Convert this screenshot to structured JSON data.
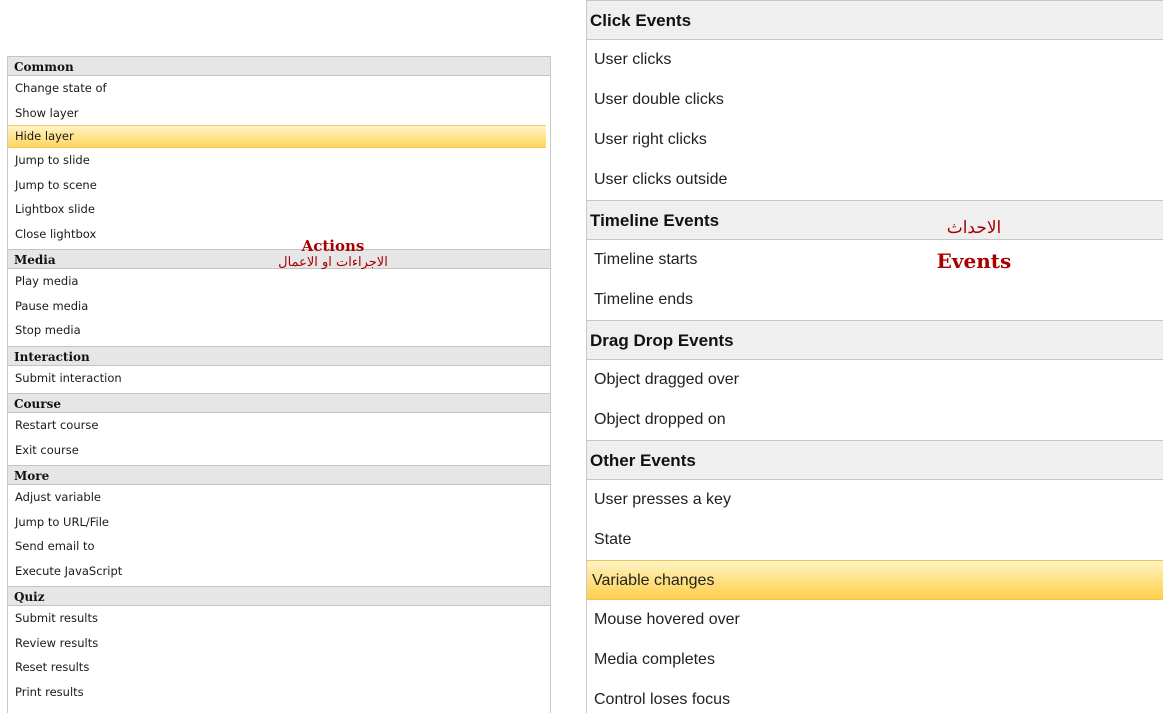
{
  "actions_panel": {
    "groups": [
      {
        "header": "Common",
        "items": [
          "Change state of",
          "Show layer",
          "Hide layer",
          "Jump to slide",
          "Jump to scene",
          "Lightbox slide",
          "Close lightbox"
        ]
      },
      {
        "header": "Media",
        "items": [
          "Play media",
          "Pause media",
          "Stop media"
        ]
      },
      {
        "header": "Interaction",
        "items": [
          "Submit interaction"
        ]
      },
      {
        "header": "Course",
        "items": [
          "Restart course",
          "Exit course"
        ]
      },
      {
        "header": "More",
        "items": [
          "Adjust variable",
          "Jump to URL/File",
          "Send email to",
          "Execute JavaScript"
        ]
      },
      {
        "header": "Quiz",
        "items": [
          "Submit results",
          "Review results",
          "Reset results",
          "Print results"
        ]
      }
    ],
    "selected_item": "Hide layer"
  },
  "actions_annotation": {
    "english": "Actions",
    "arabic": "الاجراءات او الاعمال"
  },
  "events_panel": {
    "groups": [
      {
        "header": "Click Events",
        "items": [
          "User clicks",
          "User double clicks",
          "User right clicks",
          "User clicks outside"
        ]
      },
      {
        "header": "Timeline Events",
        "items": [
          "Timeline starts",
          "Timeline ends"
        ]
      },
      {
        "header": "Drag Drop Events",
        "items": [
          "Object dragged over",
          "Object dropped on"
        ]
      },
      {
        "header": "Other Events",
        "items": [
          "User presses a key",
          "State",
          "Variable changes",
          "Mouse hovered over",
          "Media completes",
          "Control loses focus"
        ]
      }
    ],
    "selected_item": "Variable changes"
  },
  "events_annotation": {
    "arabic": "الاحداث",
    "english": "Events"
  },
  "colors": {
    "selection": "#ffd55a",
    "header_bg": "#e6e6e6",
    "annotation": "#a80000"
  }
}
